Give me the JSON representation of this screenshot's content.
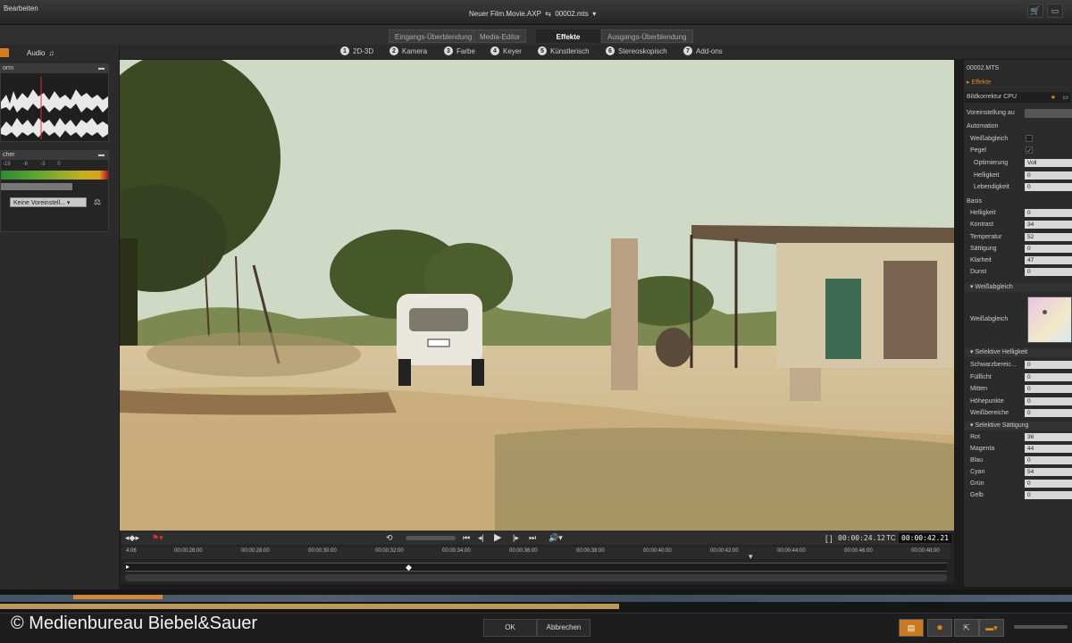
{
  "topbar": {
    "menu_label": "Bearbeiten",
    "project": "Neuer Film.Movie.AXP",
    "clip": "00002.mts"
  },
  "tabs": [
    "Eingangs-Überblendung",
    "Media-Editor",
    "Effekte",
    "Ausgangs-Überblendung"
  ],
  "categories": [
    {
      "num": "1",
      "label": "2D-3D"
    },
    {
      "num": "2",
      "label": "Kamera"
    },
    {
      "num": "3",
      "label": "Farbe"
    },
    {
      "num": "4",
      "label": "Keyer"
    },
    {
      "num": "5",
      "label": "Künstlerisch"
    },
    {
      "num": "6",
      "label": "Stereoskopisch"
    },
    {
      "num": "7",
      "label": "Add-ons"
    }
  ],
  "left": {
    "audio_label": "Audio",
    "waveform_title": "orm",
    "mixer_title": "cher",
    "meter_labels": [
      "-18",
      "-6",
      "-3",
      "0"
    ],
    "preset": "Keine Voreinstell..."
  },
  "transport": {
    "tc_prefix": "TC",
    "current": "00:00:24.12",
    "total": "00:00:42.21",
    "ruler": [
      "4:06",
      "00:00:26:00",
      "00:00:28:00",
      "00:00:30:00",
      "00:00:32:00",
      "00:00:34:00",
      "00:00:36:00",
      "00:00:38:00",
      "00:00:40:00",
      "00:00:42:00",
      "00:00:44:00",
      "00:00:46:00",
      "00:00:48:00"
    ]
  },
  "right": {
    "clip": "00002.MTS",
    "effects_label": "Effekte",
    "effect_name": "Bildkorrektur CPU",
    "preset_label": "Voreinstellung au",
    "automation_label": "Automation",
    "weissabgleich_label": "Weißabgleich",
    "pegel_label": "Pegel",
    "optimierung_label": "Optimierung",
    "optimierung_value": "Voll",
    "helligkeit_label": "Helligkeit",
    "helligkeit_value": "0",
    "lebendigkeit_label": "Lebendigkeit",
    "lebendigkeit_value": "0",
    "basis_label": "Basis",
    "basis": [
      {
        "label": "Helligkeit",
        "value": "0"
      },
      {
        "label": "Kontrast",
        "value": "34"
      },
      {
        "label": "Temperatur",
        "value": "52"
      },
      {
        "label": "Sättigung",
        "value": "0"
      },
      {
        "label": "Klarheit",
        "value": "47"
      },
      {
        "label": "Dunst",
        "value": "0"
      }
    ],
    "wb_section": "Weißabgleich",
    "wb_label": "Weißabgleich",
    "sel_hell_section": "Selektive Helligkeit",
    "sel_hell": [
      {
        "label": "Schwarzbereic...",
        "value": "0"
      },
      {
        "label": "Fülllicht",
        "value": "0"
      },
      {
        "label": "Mitten",
        "value": "0"
      },
      {
        "label": "Höhepunkte",
        "value": "0"
      },
      {
        "label": "Weißbereiche",
        "value": "0"
      }
    ],
    "sel_satt_section": "Selektive Sättigung",
    "sel_satt": [
      {
        "label": "Rot",
        "value": "36"
      },
      {
        "label": "Magenta",
        "value": "44"
      },
      {
        "label": "Blau",
        "value": "0"
      },
      {
        "label": "Cyan",
        "value": "54"
      },
      {
        "label": "Grün",
        "value": "0"
      },
      {
        "label": "Gelb",
        "value": "0"
      }
    ]
  },
  "footer": {
    "copyright": "© Medienbureau Biebel&Sauer",
    "ok": "OK",
    "cancel": "Abbrechen"
  },
  "colors": {
    "accent": "#d77c1f",
    "panel": "#2b2b2b"
  }
}
